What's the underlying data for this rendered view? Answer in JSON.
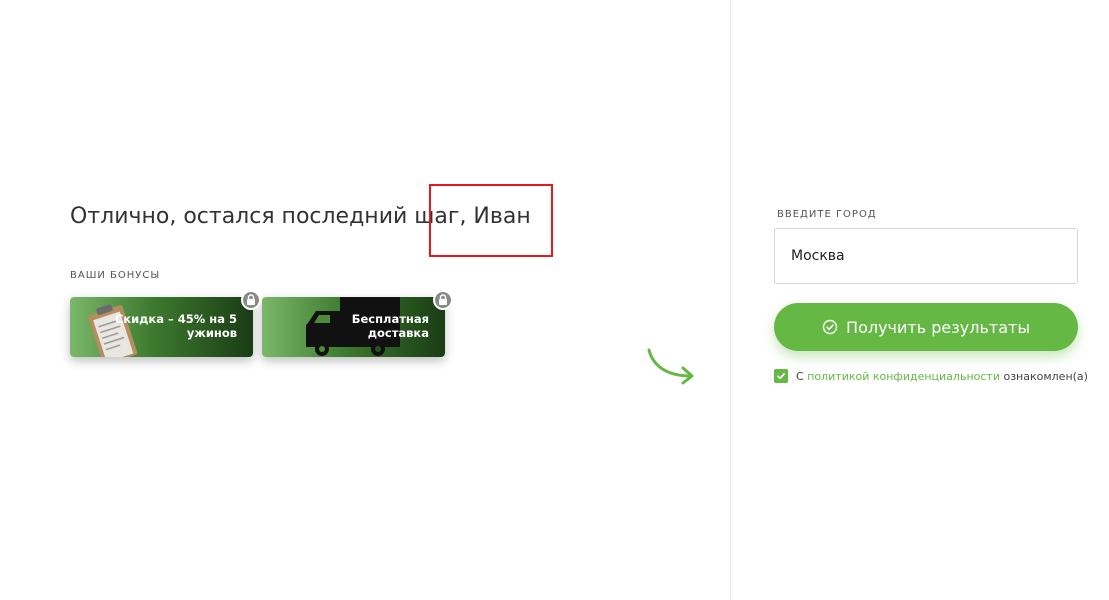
{
  "colors": {
    "accent": "#64b843",
    "highlight_box": "#e31b1b",
    "text": "#333333"
  },
  "left": {
    "heading": "Отлично, остался последний шаг, Иван",
    "bonus_section_title": "ВАШИ БОНУСЫ",
    "bonuses": [
      {
        "icon": "clipboard-icon",
        "label_line1": "Скидка – 45% на 5",
        "label_line2": "ужинов",
        "locked": true
      },
      {
        "icon": "truck-icon",
        "label_line1": "Бесплатная",
        "label_line2": "доставка",
        "locked": true
      }
    ]
  },
  "form": {
    "city_label": "ВВЕДИТЕ ГОРОД",
    "city_value": "Москва",
    "submit_label": "Получить результаты",
    "consent_prefix": "С",
    "consent_link": "политикой конфиденциальности",
    "consent_suffix": "ознакомлен(а)",
    "consent_checked": true
  }
}
